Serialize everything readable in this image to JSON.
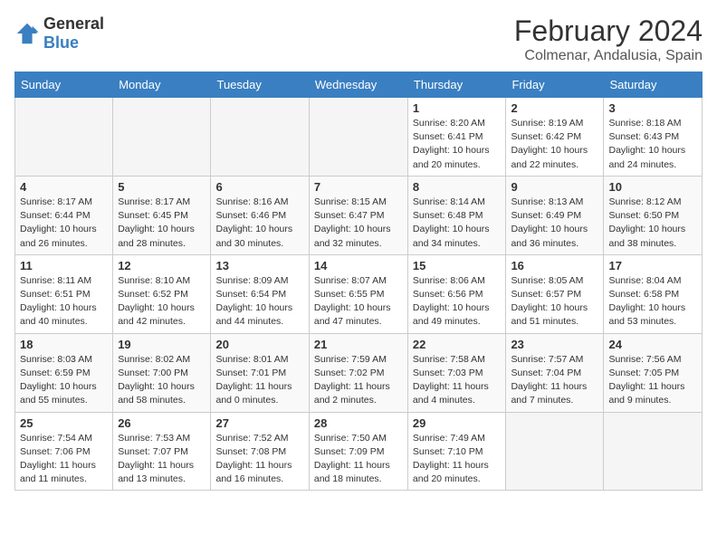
{
  "logo": {
    "general": "General",
    "blue": "Blue"
  },
  "title": "February 2024",
  "location": "Colmenar, Andalusia, Spain",
  "days_of_week": [
    "Sunday",
    "Monday",
    "Tuesday",
    "Wednesday",
    "Thursday",
    "Friday",
    "Saturday"
  ],
  "weeks": [
    [
      {
        "day": "",
        "info": ""
      },
      {
        "day": "",
        "info": ""
      },
      {
        "day": "",
        "info": ""
      },
      {
        "day": "",
        "info": ""
      },
      {
        "day": "1",
        "info": "Sunrise: 8:20 AM\nSunset: 6:41 PM\nDaylight: 10 hours\nand 20 minutes."
      },
      {
        "day": "2",
        "info": "Sunrise: 8:19 AM\nSunset: 6:42 PM\nDaylight: 10 hours\nand 22 minutes."
      },
      {
        "day": "3",
        "info": "Sunrise: 8:18 AM\nSunset: 6:43 PM\nDaylight: 10 hours\nand 24 minutes."
      }
    ],
    [
      {
        "day": "4",
        "info": "Sunrise: 8:17 AM\nSunset: 6:44 PM\nDaylight: 10 hours\nand 26 minutes."
      },
      {
        "day": "5",
        "info": "Sunrise: 8:17 AM\nSunset: 6:45 PM\nDaylight: 10 hours\nand 28 minutes."
      },
      {
        "day": "6",
        "info": "Sunrise: 8:16 AM\nSunset: 6:46 PM\nDaylight: 10 hours\nand 30 minutes."
      },
      {
        "day": "7",
        "info": "Sunrise: 8:15 AM\nSunset: 6:47 PM\nDaylight: 10 hours\nand 32 minutes."
      },
      {
        "day": "8",
        "info": "Sunrise: 8:14 AM\nSunset: 6:48 PM\nDaylight: 10 hours\nand 34 minutes."
      },
      {
        "day": "9",
        "info": "Sunrise: 8:13 AM\nSunset: 6:49 PM\nDaylight: 10 hours\nand 36 minutes."
      },
      {
        "day": "10",
        "info": "Sunrise: 8:12 AM\nSunset: 6:50 PM\nDaylight: 10 hours\nand 38 minutes."
      }
    ],
    [
      {
        "day": "11",
        "info": "Sunrise: 8:11 AM\nSunset: 6:51 PM\nDaylight: 10 hours\nand 40 minutes."
      },
      {
        "day": "12",
        "info": "Sunrise: 8:10 AM\nSunset: 6:52 PM\nDaylight: 10 hours\nand 42 minutes."
      },
      {
        "day": "13",
        "info": "Sunrise: 8:09 AM\nSunset: 6:54 PM\nDaylight: 10 hours\nand 44 minutes."
      },
      {
        "day": "14",
        "info": "Sunrise: 8:07 AM\nSunset: 6:55 PM\nDaylight: 10 hours\nand 47 minutes."
      },
      {
        "day": "15",
        "info": "Sunrise: 8:06 AM\nSunset: 6:56 PM\nDaylight: 10 hours\nand 49 minutes."
      },
      {
        "day": "16",
        "info": "Sunrise: 8:05 AM\nSunset: 6:57 PM\nDaylight: 10 hours\nand 51 minutes."
      },
      {
        "day": "17",
        "info": "Sunrise: 8:04 AM\nSunset: 6:58 PM\nDaylight: 10 hours\nand 53 minutes."
      }
    ],
    [
      {
        "day": "18",
        "info": "Sunrise: 8:03 AM\nSunset: 6:59 PM\nDaylight: 10 hours\nand 55 minutes."
      },
      {
        "day": "19",
        "info": "Sunrise: 8:02 AM\nSunset: 7:00 PM\nDaylight: 10 hours\nand 58 minutes."
      },
      {
        "day": "20",
        "info": "Sunrise: 8:01 AM\nSunset: 7:01 PM\nDaylight: 11 hours\nand 0 minutes."
      },
      {
        "day": "21",
        "info": "Sunrise: 7:59 AM\nSunset: 7:02 PM\nDaylight: 11 hours\nand 2 minutes."
      },
      {
        "day": "22",
        "info": "Sunrise: 7:58 AM\nSunset: 7:03 PM\nDaylight: 11 hours\nand 4 minutes."
      },
      {
        "day": "23",
        "info": "Sunrise: 7:57 AM\nSunset: 7:04 PM\nDaylight: 11 hours\nand 7 minutes."
      },
      {
        "day": "24",
        "info": "Sunrise: 7:56 AM\nSunset: 7:05 PM\nDaylight: 11 hours\nand 9 minutes."
      }
    ],
    [
      {
        "day": "25",
        "info": "Sunrise: 7:54 AM\nSunset: 7:06 PM\nDaylight: 11 hours\nand 11 minutes."
      },
      {
        "day": "26",
        "info": "Sunrise: 7:53 AM\nSunset: 7:07 PM\nDaylight: 11 hours\nand 13 minutes."
      },
      {
        "day": "27",
        "info": "Sunrise: 7:52 AM\nSunset: 7:08 PM\nDaylight: 11 hours\nand 16 minutes."
      },
      {
        "day": "28",
        "info": "Sunrise: 7:50 AM\nSunset: 7:09 PM\nDaylight: 11 hours\nand 18 minutes."
      },
      {
        "day": "29",
        "info": "Sunrise: 7:49 AM\nSunset: 7:10 PM\nDaylight: 11 hours\nand 20 minutes."
      },
      {
        "day": "",
        "info": ""
      },
      {
        "day": "",
        "info": ""
      }
    ]
  ]
}
